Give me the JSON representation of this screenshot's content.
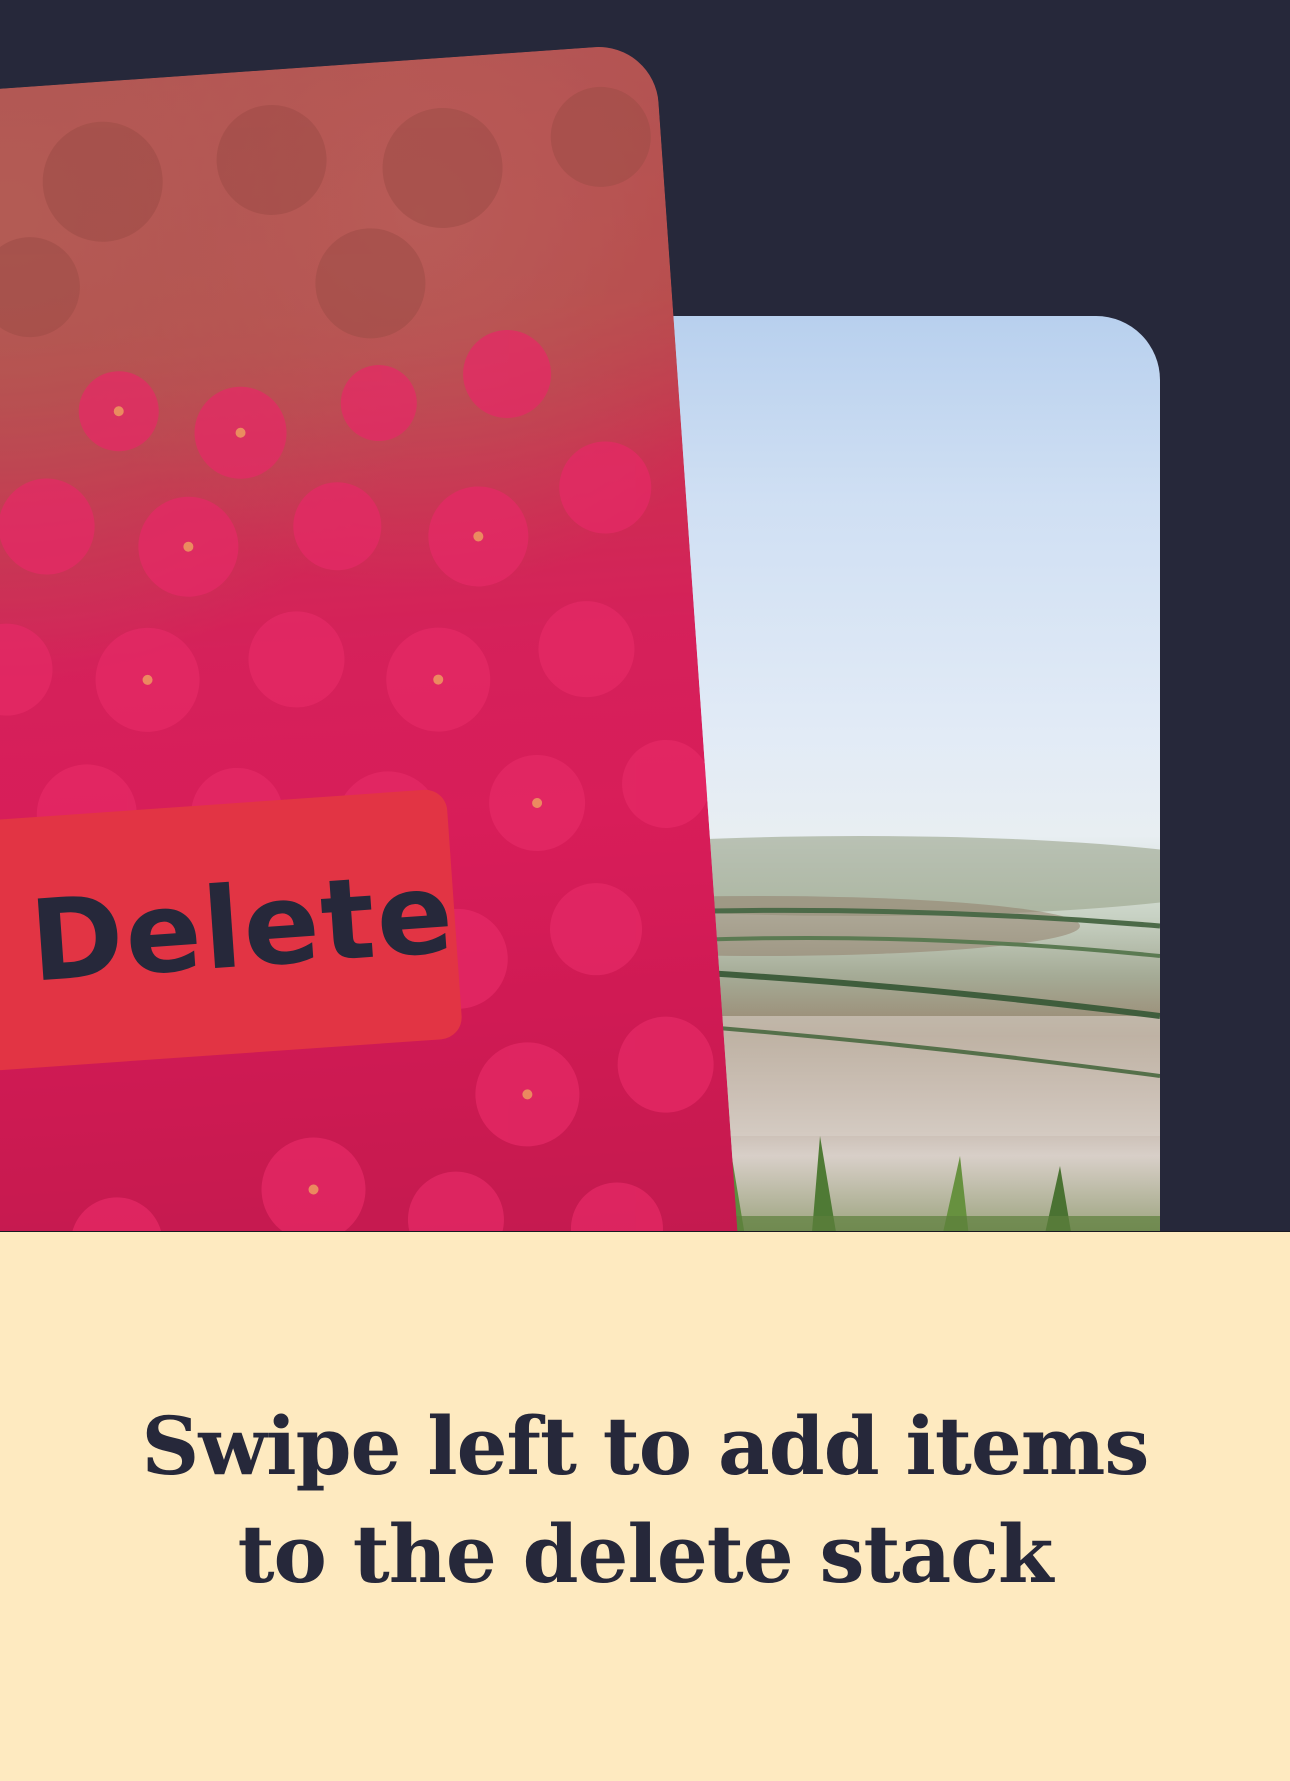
{
  "delete_badge": {
    "label": "Delete",
    "color": "#e23444"
  },
  "caption": {
    "line1": "Swipe left to add items",
    "line2": "to the delete stack"
  },
  "colors": {
    "top_background": "#26283a",
    "bottom_background": "#feeac0",
    "text": "#26283a"
  },
  "cards": {
    "front": "flower-photo",
    "back": "beach-grass-photo"
  }
}
